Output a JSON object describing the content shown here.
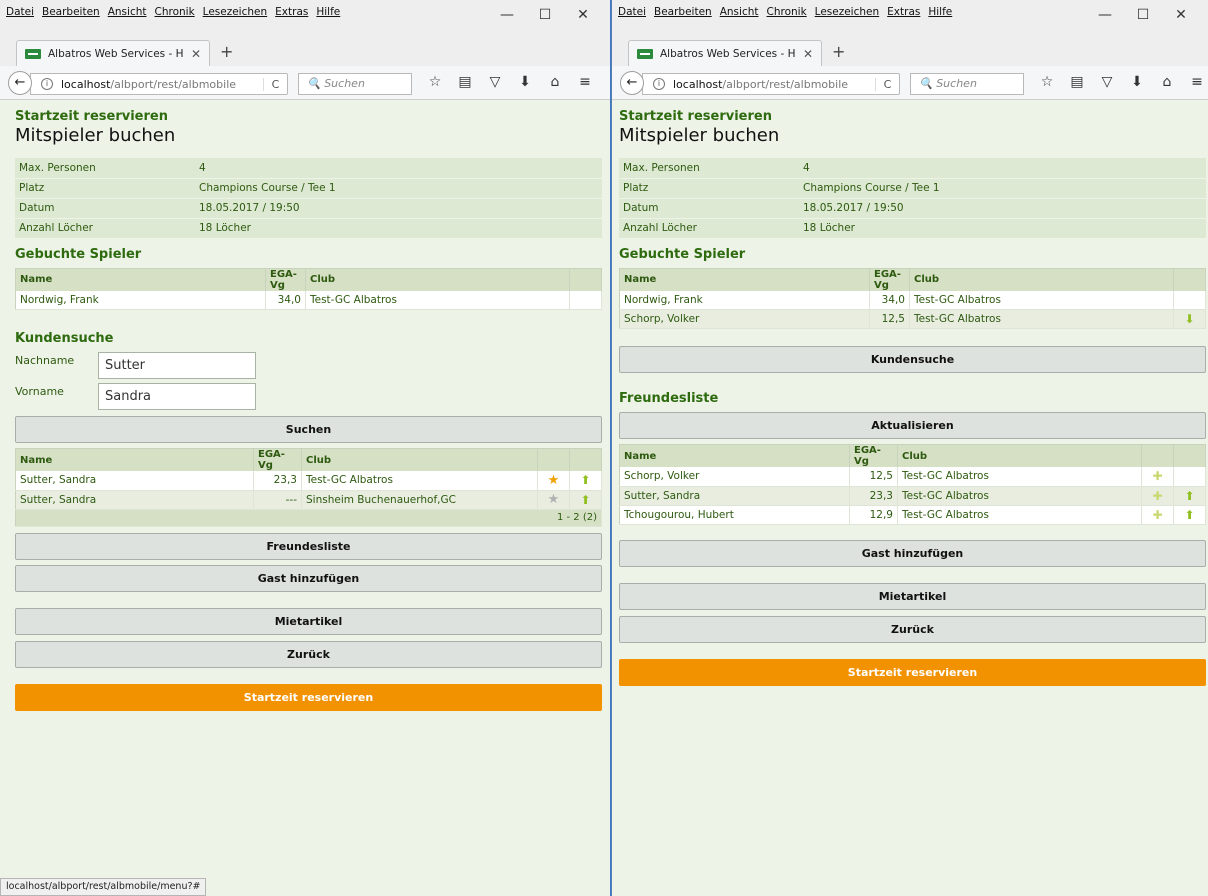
{
  "browser": {
    "menu": [
      "Datei",
      "Bearbeiten",
      "Ansicht",
      "Chronik",
      "Lesezeichen",
      "Extras",
      "Hilfe"
    ],
    "window_controls": [
      "—",
      "☐",
      "✕"
    ],
    "tab_title": "Albatros Web Services - Herz",
    "tab_close": "✕",
    "new_tab": "+",
    "url_host": "localhost",
    "url_path": "/albport/rest/albmobile",
    "search_placeholder": "Suchen",
    "icons": {
      "back": "←",
      "info": "i",
      "reload": "C",
      "search": "🔍",
      "bookmark": "☆",
      "reader": "▤",
      "pocket": "▽",
      "download": "⬇",
      "home": "⌂",
      "menu": "≡"
    },
    "status_url": "localhost/albport/rest/albmobile/menu?#"
  },
  "page": {
    "breadcrumb": "Startzeit reservieren",
    "title": "Mitspieler buchen",
    "info": [
      {
        "label": "Max. Personen",
        "value": "4"
      },
      {
        "label": "Platz",
        "value": "Champions Course / Tee 1"
      },
      {
        "label": "Datum",
        "value": "18.05.2017 / 19:50"
      },
      {
        "label": "Anzahl Löcher",
        "value": "18 Löcher"
      }
    ],
    "columns": {
      "name": "Name",
      "ega": "EGA-Vg",
      "club": "Club"
    },
    "booked_title": "Gebuchte Spieler",
    "labels": {
      "customer_search": "Kundensuche",
      "lastname": "Nachname",
      "firstname": "Vorname",
      "search": "Suchen",
      "friends": "Freundesliste",
      "refresh": "Aktualisieren",
      "add_guest": "Gast hinzufügen",
      "rental": "Mietartikel",
      "back": "Zurück",
      "reserve": "Startzeit reservieren"
    },
    "icons": {
      "star": "★",
      "arrow_up": "⬆",
      "arrow_down": "⬇",
      "add_friend": "✚"
    }
  },
  "left": {
    "booked": [
      {
        "name": "Nordwig, Frank",
        "ega": "34,0",
        "club": "Test-GC Albatros"
      }
    ],
    "search": {
      "lastname": "Sutter",
      "firstname": "Sandra"
    },
    "results": [
      {
        "name": "Sutter, Sandra",
        "ega": "23,3",
        "club": "Test-GC Albatros"
      },
      {
        "name": "Sutter, Sandra",
        "ega": "---",
        "club": "Sinsheim Buchenauerhof,GC"
      }
    ],
    "results_footer": "1 - 2 (2)"
  },
  "right": {
    "booked": [
      {
        "name": "Nordwig, Frank",
        "ega": "34,0",
        "club": "Test-GC Albatros"
      },
      {
        "name": "Schorp, Volker",
        "ega": "12,5",
        "club": "Test-GC Albatros"
      }
    ],
    "friends": [
      {
        "name": "Schorp, Volker",
        "ega": "12,5",
        "club": "Test-GC Albatros"
      },
      {
        "name": "Sutter, Sandra",
        "ega": "23,3",
        "club": "Test-GC Albatros"
      },
      {
        "name": "Tchougourou, Hubert",
        "ega": "12,9",
        "club": "Test-GC Albatros"
      }
    ]
  }
}
